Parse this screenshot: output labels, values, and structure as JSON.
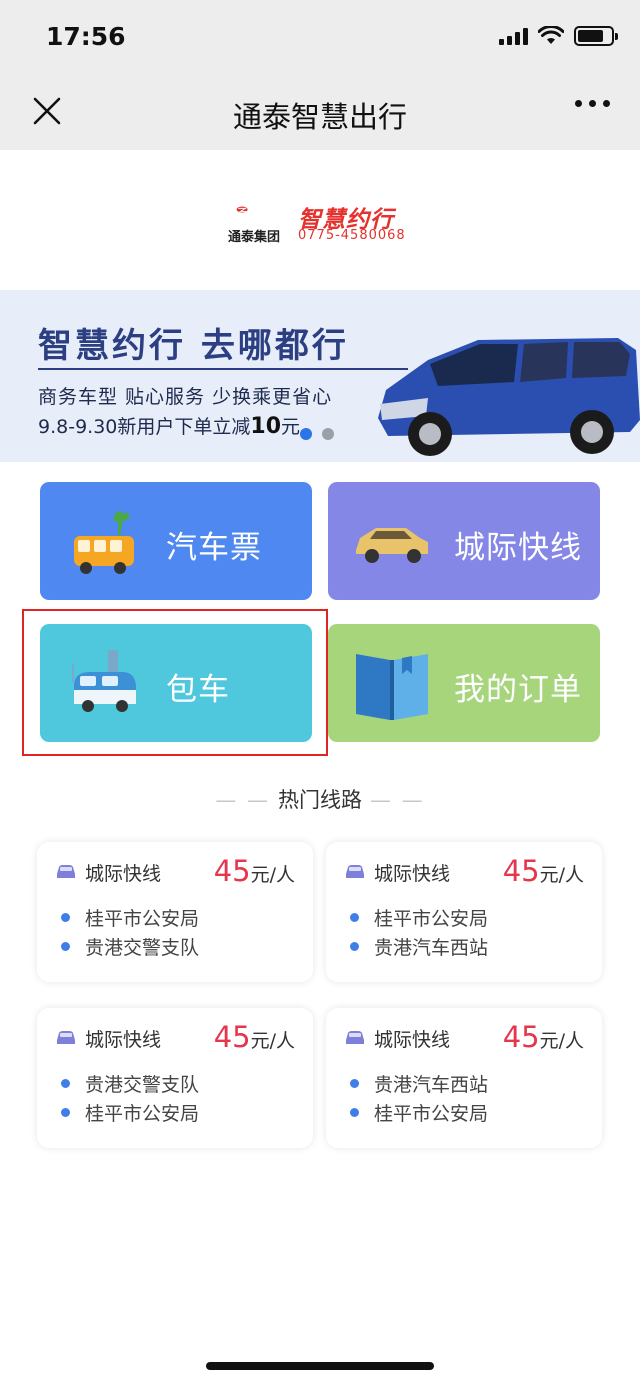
{
  "status_bar": {
    "time": "17:56"
  },
  "nav": {
    "title": "通泰智慧出行"
  },
  "logo": {
    "group_name": "通泰集团",
    "brand": "智慧约行",
    "phone": "0775-4580068"
  },
  "banner": {
    "title": "智慧约行  去哪都行",
    "subtitle": "商务车型 贴心服务 少换乘更省心",
    "promo_prefix": "9.8-9.30新用户下单立减",
    "promo_amount": "10",
    "promo_suffix": "元",
    "slides": 2,
    "active_slide": 1
  },
  "tiles": [
    {
      "label": "汽车票",
      "icon": "bus-icon",
      "color": "#4f88f0"
    },
    {
      "label": "城际快线",
      "icon": "car-icon",
      "color": "#8587e6"
    },
    {
      "label": "包车",
      "icon": "van-icon",
      "color": "#4fc7dd",
      "highlighted": true
    },
    {
      "label": "我的订单",
      "icon": "book-icon",
      "color": "#a6d57c"
    }
  ],
  "section": {
    "title": "热门线路"
  },
  "routes": [
    {
      "type": "城际快线",
      "price": "45",
      "unit": "元/人",
      "from": "桂平市公安局",
      "to": "贵港交警支队"
    },
    {
      "type": "城际快线",
      "price": "45",
      "unit": "元/人",
      "from": "桂平市公安局",
      "to": "贵港汽车西站"
    },
    {
      "type": "城际快线",
      "price": "45",
      "unit": "元/人",
      "from": "贵港交警支队",
      "to": "桂平市公安局"
    },
    {
      "type": "城际快线",
      "price": "45",
      "unit": "元/人",
      "from": "贵港汽车西站",
      "to": "桂平市公安局"
    }
  ],
  "colors": {
    "accent_red": "#e5364c",
    "stop_dot": "#3f7de8",
    "highlight_border": "#e02424"
  }
}
